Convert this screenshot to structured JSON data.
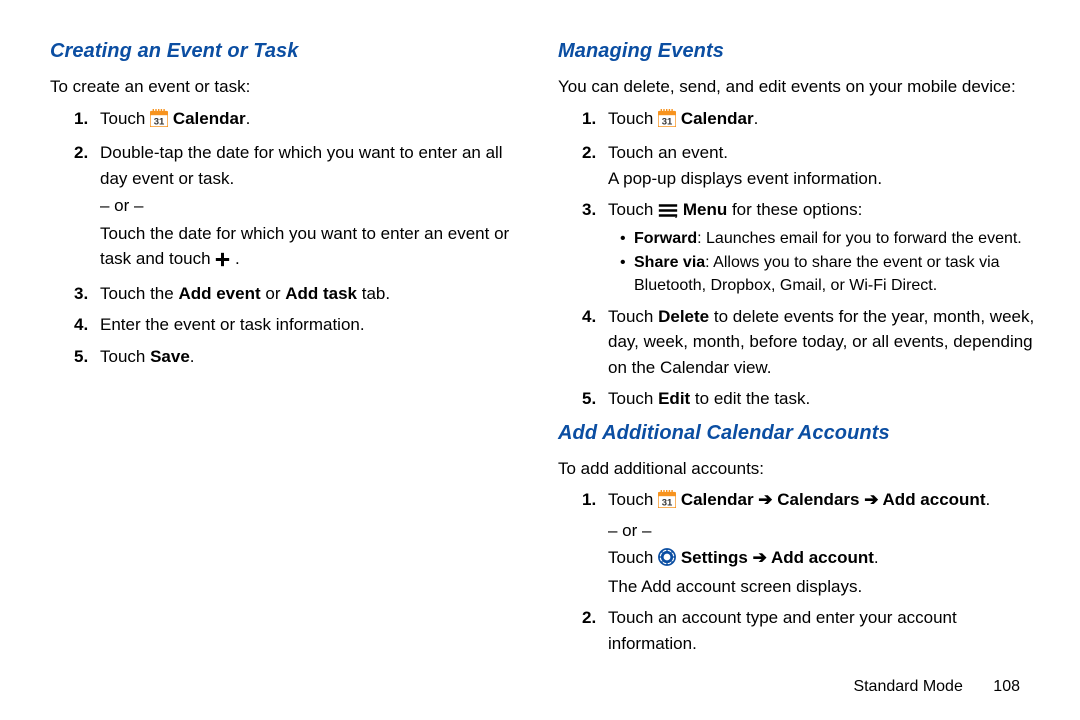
{
  "left": {
    "heading": "Creating an Event or Task",
    "intro": "To create an event or task:",
    "step1_pre": "Touch ",
    "step1_post": " Calendar",
    "step1_dot": ".",
    "step2": "Double-tap the date for which you want to enter an all day event or task.",
    "or": "– or –",
    "step2b_pre": "Touch the date for which you want to enter an event or task and touch ",
    "step2b_post": " .",
    "step3_pre": "Touch the ",
    "step3_b1": "Add event",
    "step3_mid": " or ",
    "step3_b2": "Add task",
    "step3_post": " tab.",
    "step4": "Enter the event or task information.",
    "step5_pre": "Touch ",
    "step5_b": "Save",
    "step5_post": "."
  },
  "right": {
    "heading1": "Managing Events",
    "intro1": "You can delete, send, and edit events on your mobile device:",
    "r1_pre": "Touch ",
    "r1_b": " Calendar",
    "r1_dot": ".",
    "r2": "Touch an event.",
    "r2_sub": "A pop-up displays event information.",
    "r3_pre": "Touch ",
    "r3_b": " Menu",
    "r3_post": " for these options:",
    "b1_b": "Forward",
    "b1_t": ": Launches email for you to forward the event.",
    "b2_b": "Share via",
    "b2_t": ": Allows you to share the event or task via Bluetooth, Dropbox, Gmail, or Wi-Fi Direct.",
    "r4_pre": "Touch ",
    "r4_b": "Delete",
    "r4_post": " to delete events for the year, month, week, day, week, month, before today, or all events, depending on the Calendar view.",
    "r5_pre": "Touch ",
    "r5_b": "Edit",
    "r5_post": " to edit the task.",
    "heading2": "Add Additional Calendar Accounts",
    "intro2": "To add additional accounts:",
    "a1_pre": "Touch ",
    "a1_b": " Calendar ➔ Calendars ➔ Add account",
    "a1_dot": ".",
    "or2": "– or –",
    "a1b_pre": "Touch ",
    "a1b_b": " Settings ➔ Add account",
    "a1b_dot": ".",
    "a1_sub": "The Add account screen displays.",
    "a2": "Touch an account type and enter your account information."
  },
  "footer": {
    "mode": "Standard Mode",
    "page": "108"
  },
  "nums": {
    "n1": "1.",
    "n2": "2.",
    "n3": "3.",
    "n4": "4.",
    "n5": "5."
  }
}
